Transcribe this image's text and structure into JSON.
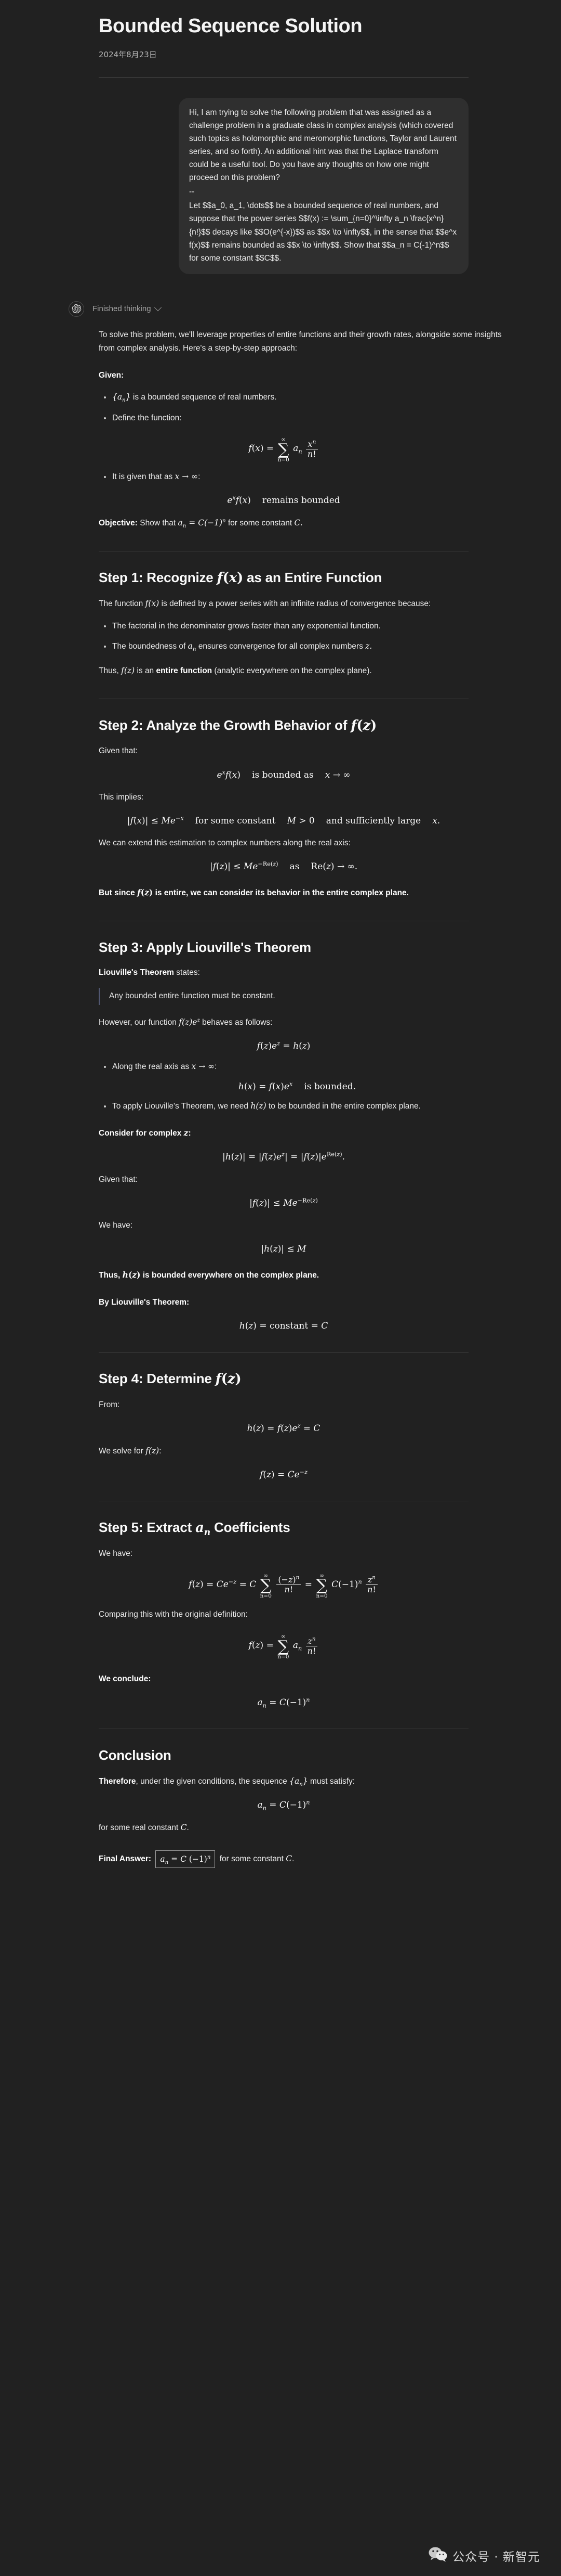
{
  "header": {
    "title": "Bounded Sequence Solution",
    "date": "2024年8月23日"
  },
  "user_message": {
    "paragraph1": "Hi, I am trying to solve the following problem that was assigned as a challenge problem in a graduate class in complex analysis (which covered such topics as holomorphic and meromorphic functions, Taylor and Laurent series, and so forth).  An additional hint was that the Laplace transform could be a useful tool.  Do you have any thoughts on how one might proceed on this problem?",
    "separator": "--",
    "paragraph2": "Let $$a_0, a_1, \\dots$$ be a bounded sequence of real numbers, and suppose that the power series $$f(x) := \\sum_{n=0}^\\infty a_n \\frac{x^n}{n!}$$ decays like $$O(e^{-x})$$ as $$x \\to \\infty$$, in the sense that $$e^x f(x)$$ remains bounded as $$x \\to \\infty$$.  Show that $$a_n = C(-1)^n$$ for some constant $$C$$."
  },
  "assistant": {
    "thinking_label": "Finished thinking",
    "intro": "To solve this problem, we'll leverage properties of entire functions and their growth rates, alongside some insights from complex analysis. Here's a step-by-step approach:",
    "given_label": "Given:",
    "given_bullets": [
      "is a bounded sequence of real numbers.",
      "Define the function:"
    ],
    "given_bullet3": "It is given that as",
    "given_bullet3_tail": ":",
    "eq_fx_def": "f(x) = \\sum_{n=0}^{\\infty} a_n \\frac{x^n}{n!}",
    "eq_remains_bounded_text": "remains bounded",
    "objective_label": "Objective:",
    "objective_text_pre": "Show that",
    "objective_text_post": "for some constant",
    "steps": [
      {
        "heading_pre": "Step 1: Recognize",
        "heading_post": "as an Entire Function",
        "para1_pre": "The function",
        "para1_post": "is defined by a power series with an infinite radius of convergence because:",
        "bullets": [
          "The factorial in the denominator grows faster than any exponential function.",
          "The boundedness of"
        ],
        "bullet2_tail": "ensures convergence for all complex numbers",
        "thus_pre": "Thus,",
        "thus_mid": "is an",
        "thus_bold": "entire function",
        "thus_post": "(analytic everywhere on the complex plane)."
      },
      {
        "heading_pre": "Step 2: Analyze the Growth Behavior of",
        "given_that": "Given that:",
        "eq1_a": "e^x f(x)",
        "eq1_b": "is bounded as",
        "eq1_c": "x \\to \\infty",
        "this_implies": "This implies:",
        "eq2_a": "|f(x)| \\le M e^{-x}",
        "eq2_b": "for some constant",
        "eq2_c": "M > 0",
        "eq2_d": "and sufficiently large",
        "eq2_e": "x.",
        "extend": "We can extend this estimation to complex numbers along the real axis:",
        "eq3_a": "|f(z)| \\le M e^{-\\operatorname{Re}(z)}",
        "eq3_b": "as",
        "eq3_c": "\\operatorname{Re}(z) \\to \\infty.",
        "but_since_pre": "But since",
        "but_since_post": "is entire, we can consider its behavior in the entire complex plane."
      },
      {
        "heading": "Step 3: Apply Liouville's Theorem",
        "liouville_bold": "Liouville's Theorem",
        "liouville_rest": "states:",
        "quote": "Any bounded entire function must be constant.",
        "however_pre": "However, our function",
        "however_post": "behaves as follows:",
        "eq_h": "f(z)e^z = h(z)",
        "bullet1_pre": "Along the real axis as",
        "bullet1_post": ":",
        "eq_hx": "h(x) = f(x)e^x",
        "eq_hx_tail": "is bounded.",
        "bullet2_pre": "To apply Liouville's Theorem, we need",
        "bullet2_post": "to be bounded in the entire complex plane.",
        "consider_pre": "Consider for complex",
        "consider_post": ":",
        "eq_habs": "|h(z)| = |f(z)e^z| = |f(z)|e^{\\operatorname{Re}(z)}.",
        "given_that": "Given that:",
        "eq_fbound": "|f(z)| \\le M e^{-\\operatorname{Re}(z)}",
        "we_have": "We have:",
        "eq_hbound": "|h(z)| \\le M",
        "thus_pre": "Thus,",
        "thus_post": "is bounded everywhere on the complex plane.",
        "by_liouville": "By Liouville's Theorem:",
        "eq_const": "h(z) = \\mathrm{constant} = C"
      },
      {
        "heading_pre": "Step 4: Determine",
        "from_label": "From:",
        "eq_from": "h(z) = f(z)e^z = C",
        "we_solve_pre": "We solve for",
        "we_solve_post": ":",
        "eq_solve": "f(z) = C e^{-z}"
      },
      {
        "heading_pre": "Step 5: Extract",
        "heading_post": "Coefficients",
        "we_have": "We have:",
        "eq_expand": "f(z) = Ce^{-z} = C\\sum_{n=0}^{\\infty}\\frac{(-z)^n}{n!} = \\sum_{n=0}^{\\infty} C(-1)^n\\frac{z^n}{n!}",
        "comparing": "Comparing this with the original definition:",
        "eq_orig": "f(z) = \\sum_{n=0}^{\\infty} a_n \\frac{z^n}{n!}",
        "we_conclude": "We conclude:",
        "eq_an": "a_n = C(-1)^n"
      }
    ],
    "conclusion": {
      "heading": "Conclusion",
      "therefore_bold": "Therefore",
      "therefore_mid": ", under the given conditions, the sequence",
      "therefore_post": "must satisfy:",
      "eq_an": "a_n = C(-1)^n",
      "for_some_pre": "for some real constant",
      "for_some_post": ".",
      "final_label": "Final Answer:",
      "final_boxed": "a_n = C(-1)^n",
      "final_tail_pre": "for some constant",
      "final_tail_post": "."
    }
  },
  "watermark": {
    "text": "公众号 · 新智元",
    "icon": "wechat-icon"
  },
  "colors": {
    "background": "#212121",
    "user_bubble": "#2f2f2f",
    "text": "#ececec",
    "muted": "#b4b4b4",
    "rule": "#4d4d4d",
    "quote_border": "#545a75"
  }
}
